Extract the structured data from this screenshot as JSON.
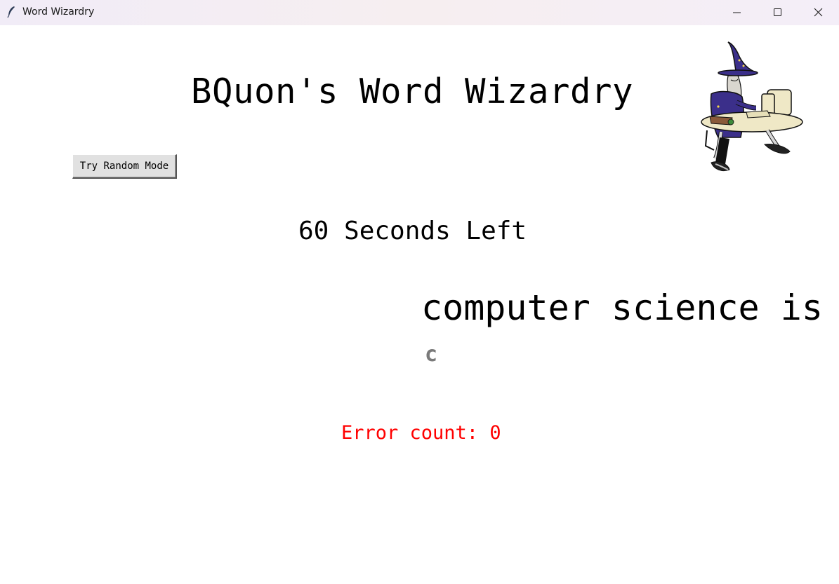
{
  "window": {
    "title": "Word Wizardry",
    "icon": "feather-icon",
    "controls": [
      "minimize-icon",
      "maximize-icon",
      "close-icon"
    ]
  },
  "app": {
    "title": "BQuon's Word Wizardry",
    "random_mode_button": "Try Random Mode",
    "timer_text": "60 Seconds Left",
    "prompt_text": "computer science is",
    "typed_text": "c",
    "error_count_text": "Error count: 0"
  },
  "colors": {
    "error": "#ff0000",
    "typed": "#7a7a7a",
    "text": "#000000",
    "button_bg": "#e1e1e1"
  }
}
